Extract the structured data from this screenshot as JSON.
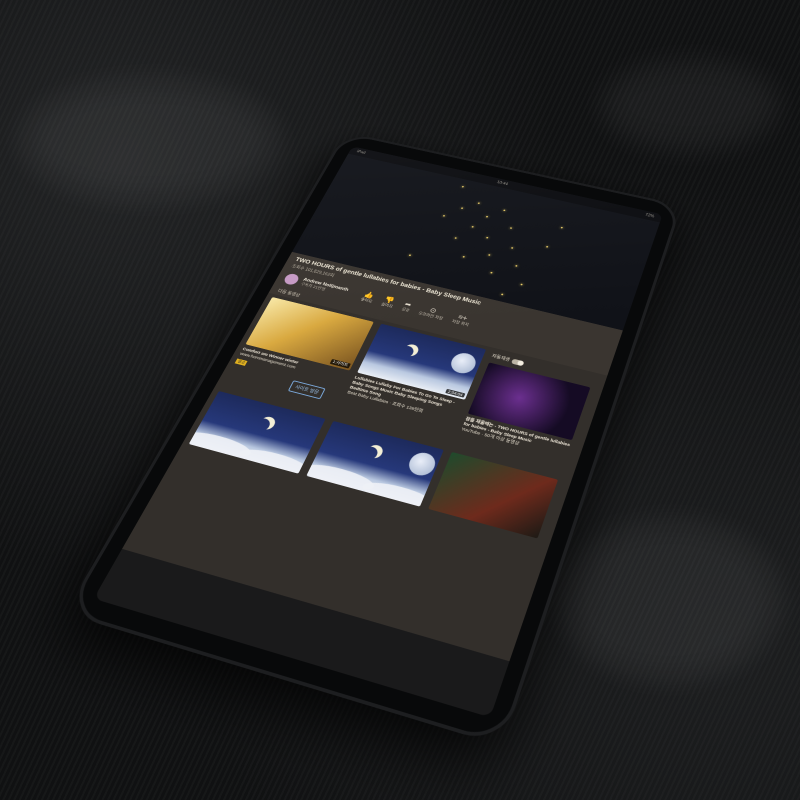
{
  "status_bar": {
    "carrier": "iPad",
    "time": "10:44",
    "battery": "72%"
  },
  "video": {
    "title": "TWO HOURS of gentle lullabies for babies - Baby Sleep Music",
    "views": "조회수 101,829,162회"
  },
  "channel": {
    "name": "Andrew Nolljmanth",
    "subscribers": "구독자 21만명"
  },
  "actions": [
    {
      "icon": "thumbs-up-icon",
      "label": "좋아요"
    },
    {
      "icon": "thumbs-down-icon",
      "label": "싫어요"
    },
    {
      "icon": "share-icon",
      "label": "공유"
    },
    {
      "icon": "offline-icon",
      "label": "오프라인 저장"
    },
    {
      "icon": "save-icon",
      "label": "저장 위치"
    }
  ],
  "up_next_label": "다음 동영상",
  "autoplay_label": "자동재생",
  "ad": {
    "title": "Comfort am Winner winter",
    "subtitle": "www.hornmanagement.com",
    "ad_tag": "광고",
    "visit_button": "사이트 방문",
    "thumb_badge": "1:사이트"
  },
  "recommendations": [
    {
      "title": "Lullabies Lullaby For Babies To Go To Sleep - Baby Songs Music Baby Sleeping Songs Bedtime Song",
      "meta": "Best Baby Lullabies · 조회수 139만회",
      "duration": "2:04:04"
    },
    {
      "title": "잠을 재울때는 - TWO HOURS of gentle lullabies for babies - Baby Sleep Music",
      "meta": "YouTube · 50개 이상 동영상"
    }
  ],
  "colors": {
    "panel": "#3a3530",
    "accent_star": "#f2d46a",
    "link_blue": "#9cc4ee"
  }
}
